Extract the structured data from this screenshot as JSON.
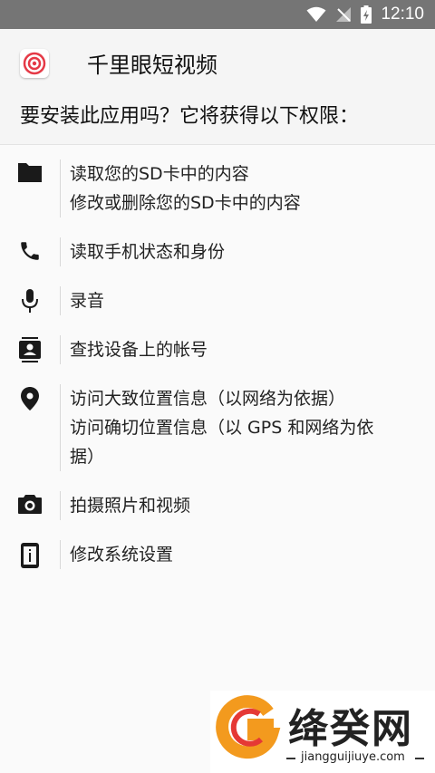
{
  "status_bar": {
    "time": "12:10"
  },
  "header": {
    "app_name": "千里眼短视频",
    "question": "要安装此应用吗？它将获得以下权限："
  },
  "permissions": [
    {
      "icon": "folder-icon",
      "lines": [
        "读取您的SD卡中的内容",
        "修改或删除您的SD卡中的内容"
      ]
    },
    {
      "icon": "phone-icon",
      "lines": [
        "读取手机状态和身份"
      ]
    },
    {
      "icon": "microphone-icon",
      "lines": [
        "录音"
      ]
    },
    {
      "icon": "contacts-icon",
      "lines": [
        "查找设备上的帐号"
      ]
    },
    {
      "icon": "location-pin-icon",
      "lines": [
        "访问大致位置信息（以网络为依据）",
        "访问确切位置信息（以 GPS 和网络为依",
        "据）"
      ]
    },
    {
      "icon": "camera-icon",
      "lines": [
        "拍摄照片和视频"
      ]
    },
    {
      "icon": "settings-phone-icon",
      "lines": [
        "修改系统设置"
      ]
    }
  ],
  "watermark": {
    "title": "绛癸网",
    "url": "jiangguijiuye.com"
  }
}
